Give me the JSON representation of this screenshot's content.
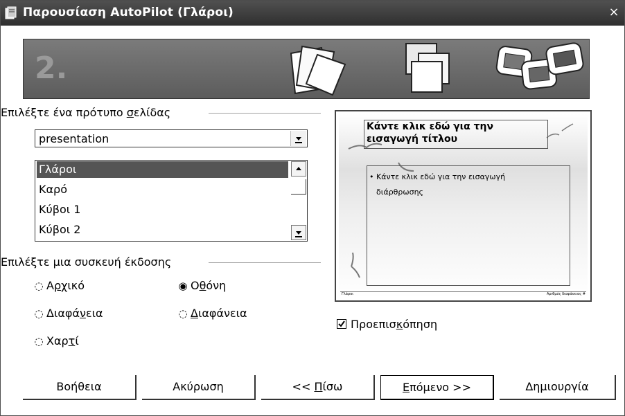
{
  "window": {
    "title": "Παρουσίαση AutoPilot (Γλάροι)",
    "close_glyph": "×"
  },
  "banner": {
    "step": "2."
  },
  "page_template": {
    "group_label_before": "Επιλέξτε ένα πρότυπο ",
    "group_label_mnemonic": "σ",
    "group_label_after": "ελίδας",
    "category_value": "presentation",
    "items": [
      "Γλάροι",
      "Καρό",
      "Κύβοι 1",
      "Κύβοι 2"
    ],
    "selected_index": 0
  },
  "output_medium": {
    "group_label": "Επιλέξτε μια συσκευή έκδοσης",
    "options": [
      {
        "pre": "Α",
        "mn": "ρ",
        "post": "χικό",
        "selected": false
      },
      {
        "pre": "Ο",
        "mn": "θ",
        "post": "όνη",
        "selected": true
      },
      {
        "pre": "Διαφά",
        "mn": "ν",
        "post": "εια",
        "selected": false
      },
      {
        "pre": "",
        "mn": "Δ",
        "post": "ιαφάνεια",
        "selected": false
      },
      {
        "pre": "Χαρ",
        "mn": "τ",
        "post": "ί",
        "selected": false
      }
    ]
  },
  "preview_slide": {
    "title_line1": "Κάντε κλικ εδώ για την",
    "title_line2": "εισαγωγή τίτλου",
    "bullet_line1": "• Κάντε κλικ εδώ για την εισαγωγή",
    "bullet_line2": "διάρθρωσης",
    "footer_left": "Γλάροι",
    "footer_right": "Αριθμός διαφάνειας #"
  },
  "preview_checkbox": {
    "before": "Προεπισ",
    "mn": "κ",
    "after": "όπηση",
    "checked": true
  },
  "buttons": {
    "help": "Βοήθεια",
    "cancel": "Ακύρωση",
    "back_pre": "<< ",
    "back_mn": "Π",
    "back_post": "ίσω",
    "next_mn": "Ε",
    "next_post": "πόμενο >>",
    "create": "Δημιουργία"
  },
  "icons": {
    "title_icon": "autopilot-presentation-icon",
    "combo_arrow": "chevron-down-icon",
    "scroll_up": "arrow-up-icon",
    "scroll_down": "arrow-down-icon"
  },
  "colors": {
    "titlebar": "#3c3c3c",
    "banner": "#6a6a6a",
    "selection": "#555555"
  }
}
